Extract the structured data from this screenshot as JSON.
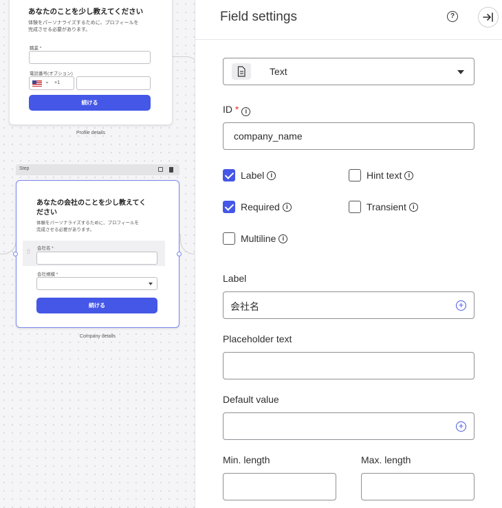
{
  "canvas": {
    "card1": {
      "title": "あなたのことを少し教えてください",
      "desc": [
        "体験をパーソナライズするために、プロフィールを",
        "完成させる必要があります。"
      ],
      "field1_label": "職業 *",
      "field2_label": "電話番号(オプション)",
      "phone_code": "+1",
      "button": "続ける",
      "caption": "Profile details"
    },
    "step_label": "Step",
    "card2": {
      "title": [
        "あなたの会社のことを少し教えてく",
        "ださい"
      ],
      "desc": [
        "体験をパーソナライズするために、プロフィールを",
        "完成させる必要があります。"
      ],
      "field1_label": "会社名 *",
      "field2_label": "会社規模 *",
      "button": "続ける",
      "caption": "Company details"
    }
  },
  "panel": {
    "title": "Field settings",
    "help_glyph": "?",
    "type_select": {
      "value": "Text",
      "icon": "document-icon"
    },
    "id": {
      "label": "ID",
      "required_mark": "*",
      "value": "company_name"
    },
    "checkboxes": {
      "label": {
        "text": "Label",
        "checked": true
      },
      "hint_text": {
        "text": "Hint text",
        "checked": false
      },
      "required": {
        "text": "Required",
        "checked": true
      },
      "transient": {
        "text": "Transient",
        "checked": false
      },
      "multiline": {
        "text": "Multiline",
        "checked": false
      }
    },
    "label_field": {
      "label": "Label",
      "value": "会社名"
    },
    "placeholder_field": {
      "label": "Placeholder text",
      "value": ""
    },
    "default_field": {
      "label": "Default value",
      "value": ""
    },
    "min_length": {
      "label": "Min. length",
      "value": ""
    },
    "max_length": {
      "label": "Max. length",
      "value": ""
    },
    "accent_color": "#4557e6"
  }
}
